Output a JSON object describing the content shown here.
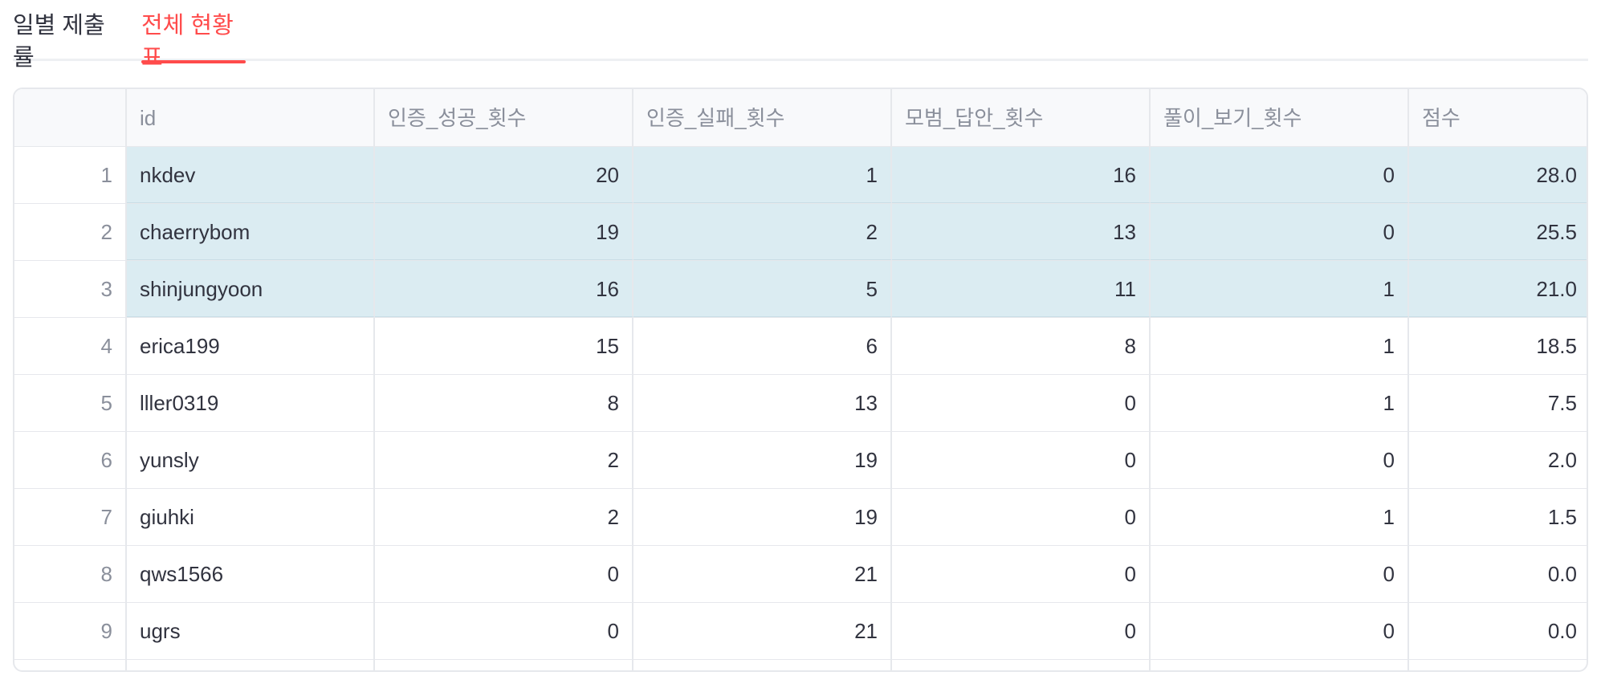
{
  "tabs": [
    {
      "label": "일별 제출률",
      "active": false
    },
    {
      "label": "전체 현황표",
      "active": true
    }
  ],
  "colors": {
    "accent": "#ff4b4b",
    "selected_row": "#dbecf2",
    "header_bg": "#f8f9fb"
  },
  "table": {
    "columns": [
      "",
      "id",
      "인증_성공_횟수",
      "인증_실패_횟수",
      "모범_답안_횟수",
      "풀이_보기_횟수",
      "점수"
    ],
    "rows": [
      [
        "1",
        "nkdev",
        "20",
        "1",
        "16",
        "0",
        "28.0"
      ],
      [
        "2",
        "chaerrybom",
        "19",
        "2",
        "13",
        "0",
        "25.5"
      ],
      [
        "3",
        "shinjungyoon",
        "16",
        "5",
        "11",
        "1",
        "21.0"
      ],
      [
        "4",
        "erica199",
        "15",
        "6",
        "8",
        "1",
        "18.5"
      ],
      [
        "5",
        "lller0319",
        "8",
        "13",
        "0",
        "1",
        "7.5"
      ],
      [
        "6",
        "yunsly",
        "2",
        "19",
        "0",
        "0",
        "2.0"
      ],
      [
        "7",
        "giuhki",
        "2",
        "19",
        "0",
        "1",
        "1.5"
      ],
      [
        "8",
        "qws1566",
        "0",
        "21",
        "0",
        "0",
        "0.0"
      ],
      [
        "9",
        "ugrs",
        "0",
        "21",
        "0",
        "0",
        "0.0"
      ]
    ],
    "selected_rows": [
      0,
      1,
      2
    ]
  }
}
